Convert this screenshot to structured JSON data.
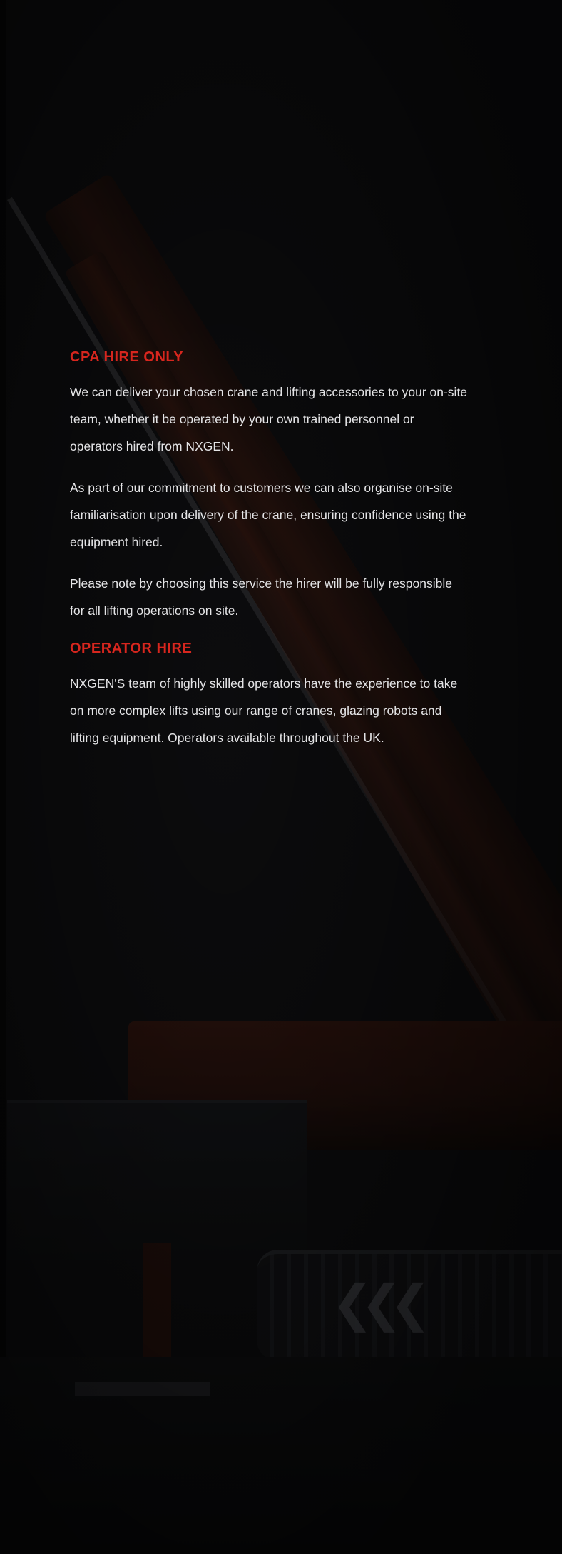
{
  "sections": [
    {
      "heading": "CPA HIRE ONLY",
      "paragraphs": [
        "We can deliver your chosen crane and lifting accessories to your on-site team, whether it be operated by your own trained personnel or operators hired from NXGEN.",
        "As part of our commitment to customers we can also organise on-site familiarisation upon delivery of the crane, ensuring confidence using the equipment hired.",
        "Please note by choosing this service the hirer will be fully responsible for all lifting operations on site."
      ]
    },
    {
      "heading": "OPERATOR HIRE",
      "paragraphs": [
        "NXGEN'S team of highly skilled operators have the experience to take on more complex lifts using our range of cranes, glazing robots and lifting equipment. Operators available throughout the UK."
      ]
    }
  ],
  "colors": {
    "accent": "#d7261e",
    "background": "#111114",
    "text": "#e4e4e6"
  }
}
